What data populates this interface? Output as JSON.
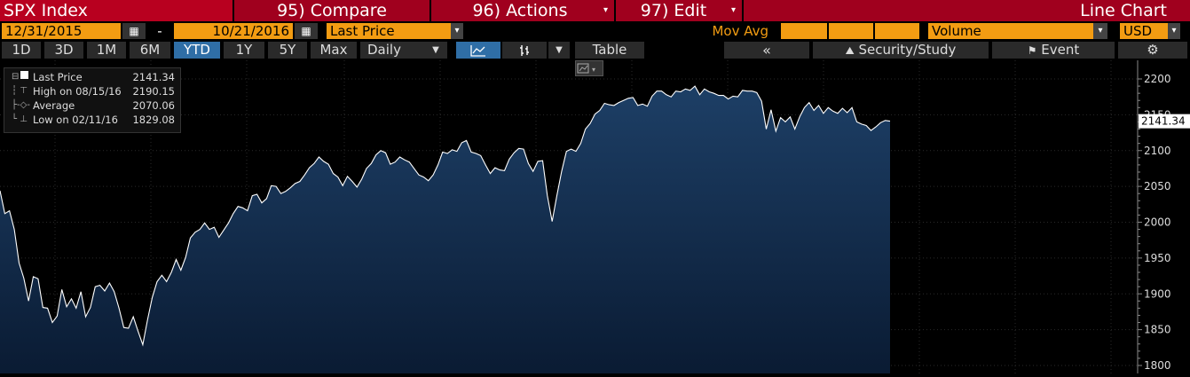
{
  "toolbar": {
    "ticker": "SPX Index",
    "compare": "95) Compare",
    "actions": "96) Actions",
    "edit": "97) Edit",
    "chart_title": "Line Chart"
  },
  "controls": {
    "start_date": "12/31/2015",
    "dash": "-",
    "end_date": "10/21/2016",
    "field": "Last Price",
    "mov_avg": "Mov Avg",
    "volume": "Volume",
    "currency": "USD"
  },
  "periods": [
    "1D",
    "3D",
    "1M",
    "6M",
    "YTD",
    "1Y",
    "5Y",
    "Max"
  ],
  "active_period": "YTD",
  "frequency": "Daily",
  "table_label": "Table",
  "nav": {
    "back": "«",
    "security_study": "Security/Study",
    "event": "Event",
    "gear": "⚙"
  },
  "legend": {
    "last_label": "Last Price",
    "last_value": "2141.34",
    "high_label": "High on 08/15/16",
    "high_value": "2190.15",
    "avg_label": "Average",
    "avg_value": "2070.06",
    "low_label": "Low on 02/11/16",
    "low_value": "1829.08"
  },
  "colors": {
    "accent_red": "#a0001e",
    "orange": "#f39c12",
    "area_top": "#1d3f66",
    "area_bottom": "#0a1b33",
    "line": "#ffffff"
  },
  "chart_data": {
    "type": "area",
    "x_range": [
      "12/31/2015",
      "10/21/2016"
    ],
    "ylim": [
      1800,
      2200
    ],
    "yticks": [
      1800,
      1850,
      1900,
      1950,
      2000,
      2050,
      2100,
      2150,
      2200
    ],
    "last_price_label": "2141.34",
    "grid": true,
    "series": [
      {
        "name": "Last Price",
        "values": [
          2044,
          2012,
          2016,
          1990,
          1943,
          1922,
          1890,
          1924,
          1921,
          1881,
          1880,
          1860,
          1869,
          1906,
          1882,
          1893,
          1880,
          1903,
          1868,
          1881,
          1910,
          1912,
          1904,
          1915,
          1903,
          1880,
          1853,
          1852,
          1868,
          1848,
          1829,
          1864,
          1895,
          1917,
          1926,
          1917,
          1930,
          1948,
          1933,
          1951,
          1978,
          1986,
          1990,
          1999,
          1990,
          1993,
          1979,
          1989,
          1999,
          2012,
          2022,
          2020,
          2016,
          2037,
          2039,
          2027,
          2033,
          2051,
          2050,
          2040,
          2043,
          2048,
          2054,
          2057,
          2066,
          2076,
          2082,
          2091,
          2085,
          2081,
          2068,
          2063,
          2051,
          2064,
          2057,
          2049,
          2060,
          2075,
          2082,
          2094,
          2100,
          2097,
          2081,
          2084,
          2091,
          2087,
          2084,
          2075,
          2066,
          2063,
          2058,
          2066,
          2080,
          2098,
          2096,
          2101,
          2099,
          2111,
          2114,
          2098,
          2096,
          2093,
          2080,
          2068,
          2076,
          2073,
          2072,
          2088,
          2097,
          2103,
          2102,
          2082,
          2071,
          2085,
          2086,
          2037,
          2001,
          2037,
          2071,
          2099,
          2102,
          2099,
          2110,
          2130,
          2138,
          2151,
          2156,
          2166,
          2164,
          2163,
          2167,
          2170,
          2173,
          2174,
          2163,
          2165,
          2162,
          2176,
          2183,
          2183,
          2178,
          2175,
          2183,
          2182,
          2186,
          2184,
          2190,
          2178,
          2186,
          2182,
          2180,
          2177,
          2177,
          2172,
          2176,
          2175,
          2184,
          2183,
          2183,
          2181,
          2169,
          2130,
          2157,
          2127,
          2146,
          2140,
          2147,
          2130,
          2147,
          2160,
          2167,
          2156,
          2163,
          2152,
          2160,
          2155,
          2152,
          2159,
          2153,
          2160,
          2140,
          2137,
          2135,
          2128,
          2133,
          2139,
          2142,
          2141
        ]
      }
    ]
  }
}
